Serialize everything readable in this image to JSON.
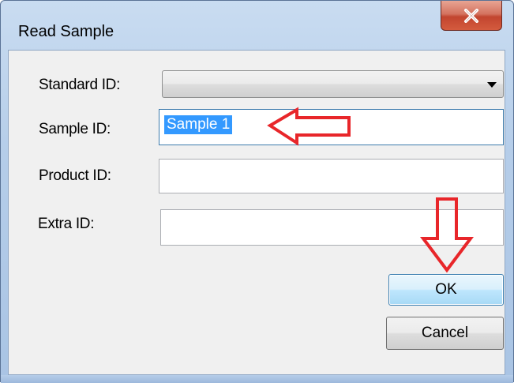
{
  "window": {
    "title": "Read Sample",
    "close_icon": "close-x-icon"
  },
  "form": {
    "standard_id": {
      "label": "Standard ID:",
      "value": ""
    },
    "sample_id": {
      "label": "Sample ID:",
      "value": "Sample 1"
    },
    "product_id": {
      "label": "Product ID:",
      "value": ""
    },
    "extra_id": {
      "label": "Extra ID:",
      "value": ""
    }
  },
  "buttons": {
    "ok": "OK",
    "cancel": "Cancel"
  },
  "annotations": {
    "color": "#e8262a",
    "arrows": [
      "left-arrow-pointing-at-sample-id",
      "down-arrow-pointing-at-ok"
    ]
  },
  "colors": {
    "selection": "#3399ff",
    "focus_border": "#3c7fb1"
  }
}
